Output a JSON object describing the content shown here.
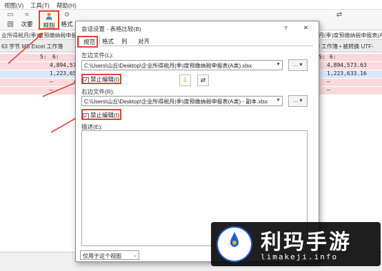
{
  "menu": {
    "view": "视图(V)",
    "tools": "工具(T)",
    "help": "帮助(H)"
  },
  "toolbar": {
    "b1": "回",
    "b2": "次要",
    "b3": "规则",
    "b4": "格式",
    "b2_icon": "≈",
    "b4_icon": "≎"
  },
  "left_title": "业所得税月(季)度预缴纳税申报表(",
  "right_title": "月(季)度预缴纳税申报表(A类) - 副本.xlsx",
  "left_info": "63 字节  MS Excel 工作簿",
  "right_info": "l 工作簿 • 被转换  UTF-",
  "left_col": "5:",
  "left_col2": "6:",
  "right_col": "5:",
  "right_col2": "6:",
  "left_rows": [
    "4,894,57",
    "1,223,65",
    "—",
    "—"
  ],
  "right_rows": [
    "4,894,573.63",
    "1,223,633.16",
    "—",
    "—"
  ],
  "dialog": {
    "title": "会话设置 - 表格比较(B)",
    "help": "?",
    "close": "✕",
    "tabs": [
      "规范",
      "格式",
      "列",
      "对齐"
    ],
    "left_file_label": "左边文件(L):",
    "left_file": "C:\\Users\\山丘\\Desktop\\企业所得税月(季)度预缴纳税申报表(A类).xlsx",
    "right_file_label": "右边文件(R):",
    "right_file": "C:\\Users\\山丘\\Desktop\\企业所得税月(季)度预缴纳税申报表(A类) - 副本.xlsx",
    "lock_left": "禁止编辑(I)",
    "lock_right": "禁止编辑(I)",
    "desc_label": "描述(E):",
    "dots": "...",
    "save_option": "仅用于这个视图"
  },
  "watermark": {
    "title": "利玛手游",
    "sub": "limakeji.info"
  },
  "colors": {
    "annotation": "#e0403a",
    "diff_row": "#f9d9dc",
    "selected_row": "#d9e9fb",
    "brand": "#1d5fd8"
  }
}
